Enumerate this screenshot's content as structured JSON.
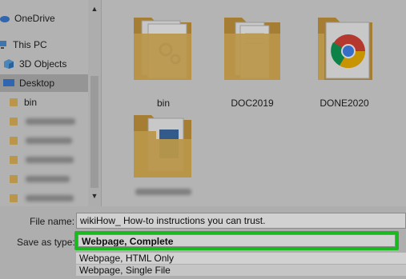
{
  "sidebar": {
    "items": [
      {
        "label": "OneDrive",
        "icon": "cloud-icon"
      },
      {
        "label": "This PC",
        "icon": "computer-icon"
      },
      {
        "label": "3D Objects",
        "icon": "cube-icon"
      },
      {
        "label": "Desktop",
        "icon": "desktop-icon",
        "selected": true
      },
      {
        "label": "bin",
        "icon": "folder-icon"
      }
    ]
  },
  "content": {
    "items": [
      {
        "name": "bin",
        "icon": "folder-with-documents-icon"
      },
      {
        "name": "DOC2019",
        "icon": "folder-with-documents-icon"
      },
      {
        "name": "DONE2020",
        "icon": "folder-chrome-icon"
      }
    ]
  },
  "form": {
    "file_name_label": "File name:",
    "file_name_value": "wikiHow_ How-to instructions you can trust.",
    "save_as_type_label": "Save as type:",
    "save_as_type_value": "Webpage, Complete",
    "type_options": [
      "Webpage, HTML Only",
      "Webpage, Single File"
    ]
  },
  "colors": {
    "highlight": "#22e02a",
    "folder": "#e3b75a"
  }
}
